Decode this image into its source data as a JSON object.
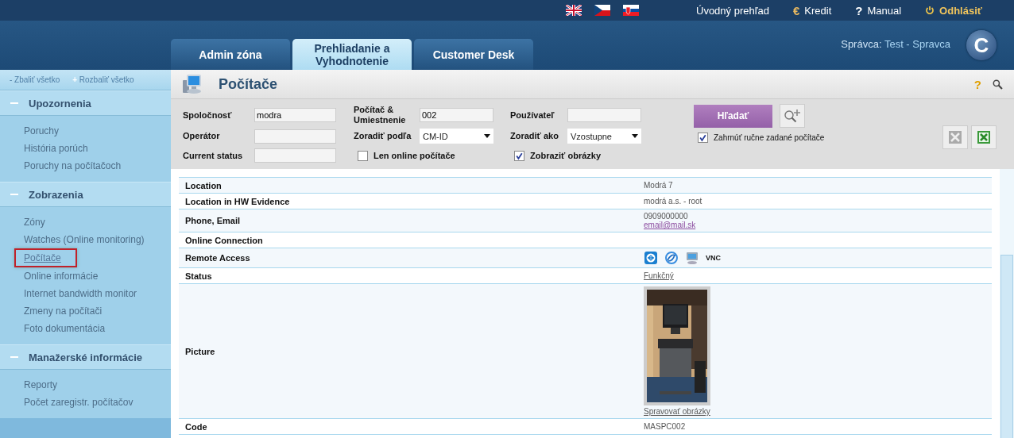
{
  "top_links": [
    {
      "kind": "home",
      "label": "Úvodný prehľad"
    },
    {
      "kind": "credit",
      "icon": "€",
      "label": "Kredit"
    },
    {
      "kind": "help",
      "icon": "?",
      "label": "Manual"
    },
    {
      "kind": "logout",
      "label": "Odhlásiť"
    }
  ],
  "user": {
    "label": "Správca:",
    "name": "Test - Spravca"
  },
  "logo": {
    "letter": "C"
  },
  "tabs": [
    {
      "label": "Admin zóna",
      "selected": false
    },
    {
      "label": "Prehliadanie a Vyhodnotenie",
      "selected": true
    },
    {
      "label": "Customer Desk",
      "selected": false
    }
  ],
  "sidebar": {
    "collapse": {
      "icon": "-",
      "label": "Zbaliť všetko"
    },
    "expand": {
      "icon": "+",
      "label": "Rozbaliť všetko"
    },
    "sections": [
      {
        "title": "Upozornenia",
        "expanded": true,
        "items": [
          {
            "label": "Poruchy",
            "selected": false
          },
          {
            "label": "História porúch",
            "selected": false
          },
          {
            "label": "Poruchy na počítačoch",
            "selected": false
          }
        ]
      },
      {
        "title": "Zobrazenia",
        "expanded": true,
        "items": [
          {
            "label": "Zóny",
            "selected": false
          },
          {
            "label": "Watches (Online monitoring)",
            "selected": false
          },
          {
            "label": "Počítače",
            "selected": true
          },
          {
            "label": "Online informácie",
            "selected": false
          },
          {
            "label": "Internet bandwidth monitor",
            "selected": false
          },
          {
            "label": "Zmeny na počítači",
            "selected": false
          },
          {
            "label": "Foto dokumentácia",
            "selected": false
          }
        ]
      },
      {
        "title": "Manažerské informácie",
        "expanded": true,
        "items": [
          {
            "label": "Reporty",
            "selected": false
          },
          {
            "label": "Počet zaregistr. počítačov",
            "selected": false
          }
        ]
      }
    ]
  },
  "page_title": "Počítače",
  "filters": {
    "columns": [
      [
        {
          "kind": "text",
          "label": "Spoločnosť",
          "value": "modra"
        },
        {
          "kind": "text",
          "label": "Operátor"
        },
        {
          "kind": "text",
          "label": "Current status"
        }
      ],
      [
        {
          "kind": "text",
          "label": "Počítač & Umiestnenie",
          "value": "002"
        },
        {
          "kind": "select",
          "label": "Zoradiť podľa",
          "value": "CM-ID"
        },
        {
          "kind": "checkbox",
          "label": "Len online počítače",
          "checked": false
        }
      ],
      [
        {
          "kind": "text",
          "label": "Používateľ"
        },
        {
          "kind": "select",
          "label": "Zoradiť ako",
          "value": "Vzostupne"
        },
        {
          "kind": "checkbox",
          "label": "Zobraziť obrázky",
          "checked": true
        }
      ]
    ],
    "search_button": "Hľadať",
    "manual_checkbox": {
      "label": "Zahrnúť ručne zadané počítače",
      "checked": true
    }
  },
  "details": [
    {
      "kind": "text",
      "label": "Location",
      "value": "Modrá 7"
    },
    {
      "kind": "text",
      "label": "Location in HW Evidence",
      "value": "modrá a.s. - root"
    },
    {
      "kind": "contact",
      "label": "Phone, Email",
      "value": "0909000000",
      "link": "email@mail.sk"
    },
    {
      "kind": "empty",
      "label": "Online Connection"
    },
    {
      "kind": "remote",
      "label": "Remote Access",
      "value": "VNC"
    },
    {
      "kind": "link",
      "label": "Status",
      "link": "Funkčný"
    },
    {
      "kind": "picture",
      "label": "Picture",
      "link": "Spravovať obrázky"
    },
    {
      "kind": "text",
      "label": "Code",
      "value": "MASPC002"
    }
  ]
}
